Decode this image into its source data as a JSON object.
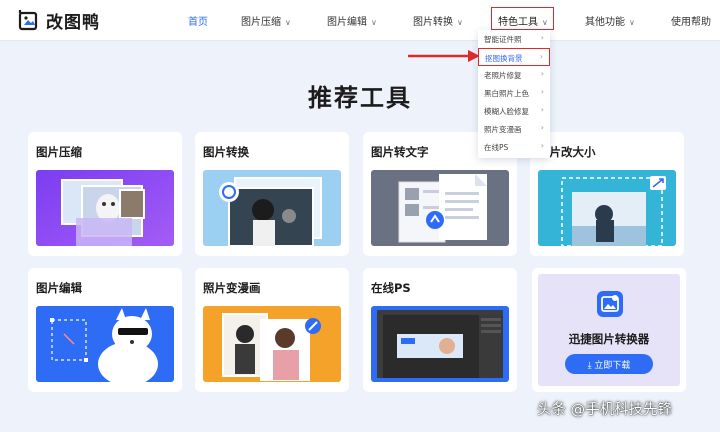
{
  "header": {
    "logo_text": "改图鸭",
    "nav": [
      {
        "label": "首页",
        "chevron": false
      },
      {
        "label": "图片压缩",
        "chevron": true
      },
      {
        "label": "图片编辑",
        "chevron": true
      },
      {
        "label": "图片转换",
        "chevron": true
      },
      {
        "label": "特色工具",
        "chevron": true
      },
      {
        "label": "其他功能",
        "chevron": true
      },
      {
        "label": "使用帮助",
        "chevron": false
      }
    ]
  },
  "dropdown": {
    "items": [
      "智能证件照",
      "抠图换背景",
      "老照片修复",
      "黑白照片上色",
      "模糊人脸修复",
      "照片变漫画",
      "在线PS"
    ],
    "highlighted_index": 1
  },
  "hero": {
    "title": "推荐工具"
  },
  "cards": [
    {
      "title": "图片压缩",
      "art": "compress"
    },
    {
      "title": "图片转换",
      "art": "convert"
    },
    {
      "title": "图片转文字",
      "art": "ocr"
    },
    {
      "title": "图片改大小",
      "art": "resize"
    },
    {
      "title": "图片编辑",
      "art": "edit"
    },
    {
      "title": "照片变漫画",
      "art": "cartoon"
    },
    {
      "title": "在线PS",
      "art": "ps"
    }
  ],
  "promo": {
    "title": "迅捷图片转换器",
    "button_label": "立即下载"
  },
  "watermark": "头条 @手机科技先锋",
  "colors": {
    "accent": "#2f6cf6",
    "highlight_border": "#e02a2a",
    "page_bg": "#eef3fb"
  }
}
